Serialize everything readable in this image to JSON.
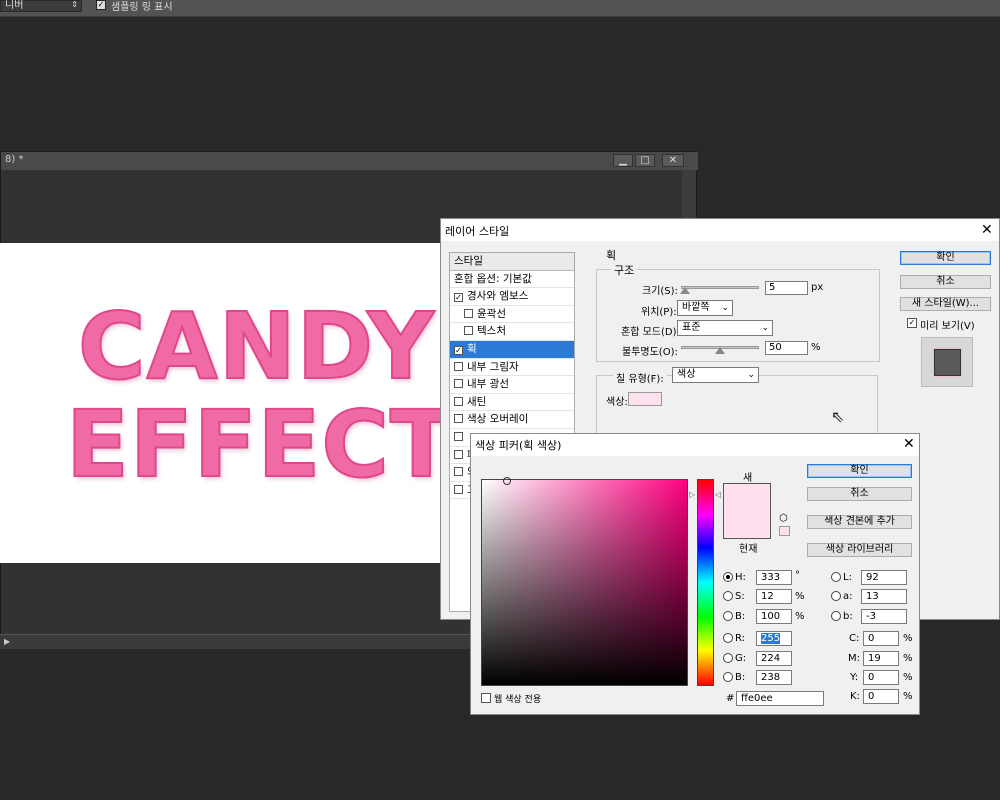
{
  "options_bar": {
    "select_value": "니버",
    "sample_ring_label": "샘플링 링 표시",
    "sample_ring_checked": true
  },
  "document": {
    "title": "8) *",
    "canvas_text_line1": "CANDY",
    "canvas_text_line2": "EFFECT",
    "text_color": "#f06aa5"
  },
  "layer_style": {
    "title": "레이어 스타일",
    "list_header": "스타일",
    "items": [
      {
        "label": "혼합 옵션: 기본값",
        "type": "header"
      },
      {
        "label": "경사와 엠보스",
        "checked": true,
        "indent": false
      },
      {
        "label": "윤곽선",
        "checked": false,
        "indent": true
      },
      {
        "label": "텍스처",
        "checked": false,
        "indent": true
      },
      {
        "label": "획",
        "checked": true,
        "indent": false,
        "selected": true
      },
      {
        "label": "내부 그림자",
        "checked": false,
        "indent": false
      },
      {
        "label": "내부 광선",
        "checked": false,
        "indent": false
      },
      {
        "label": "새틴",
        "checked": false,
        "indent": false
      },
      {
        "label": "색상 오버레이",
        "checked": false,
        "indent": false
      },
      {
        "label": "",
        "checked": false,
        "indent": false
      },
      {
        "label": "패",
        "checked": false,
        "indent": false
      },
      {
        "label": "외",
        "checked": false,
        "indent": false
      },
      {
        "label": "그",
        "checked": false,
        "indent": false
      }
    ],
    "section_title": "획",
    "structure_title": "구조",
    "size_label": "크기(S):",
    "size_value": "5",
    "size_unit": "px",
    "position_label": "위치(P):",
    "position_value": "바깥쪽",
    "blend_label": "혼합 모드(D):",
    "blend_value": "표준",
    "opacity_label": "불투명도(O):",
    "opacity_value": "50",
    "opacity_unit": "%",
    "size_slider_level": 0.05,
    "opacity_slider_level": 0.5,
    "fill_type_label": "칠 유형(F):",
    "fill_type_value": "색상",
    "color_label": "색상:",
    "stroke_color": "#ffe0ee",
    "ok": "확인",
    "cancel": "취소",
    "new_style": "새 스타일(W)...",
    "preview": "미리 보기(V)",
    "preview_checked": true
  },
  "color_picker": {
    "title": "색상 피커(획 색상)",
    "new_label": "새",
    "current_label": "현재",
    "ok": "확인",
    "cancel": "취소",
    "add_swatch": "색상 견본에 추가",
    "libraries": "색상 라이브러리",
    "H": "333",
    "H_unit": "°",
    "S": "12",
    "S_unit": "%",
    "B": "100",
    "B_unit": "%",
    "R": "255",
    "G": "224",
    "Bv": "238",
    "L": "92",
    "a": "13",
    "b": "-3",
    "C": "0",
    "M": "19",
    "Y": "0",
    "K": "0",
    "pct": "%",
    "hex_label": "#",
    "hex": "ffe0ee",
    "web_only": "웹 색상 전용",
    "new_color": "#ffe0ee",
    "current_color": "#ffe0ee",
    "hue_accent": "#ff0080"
  }
}
